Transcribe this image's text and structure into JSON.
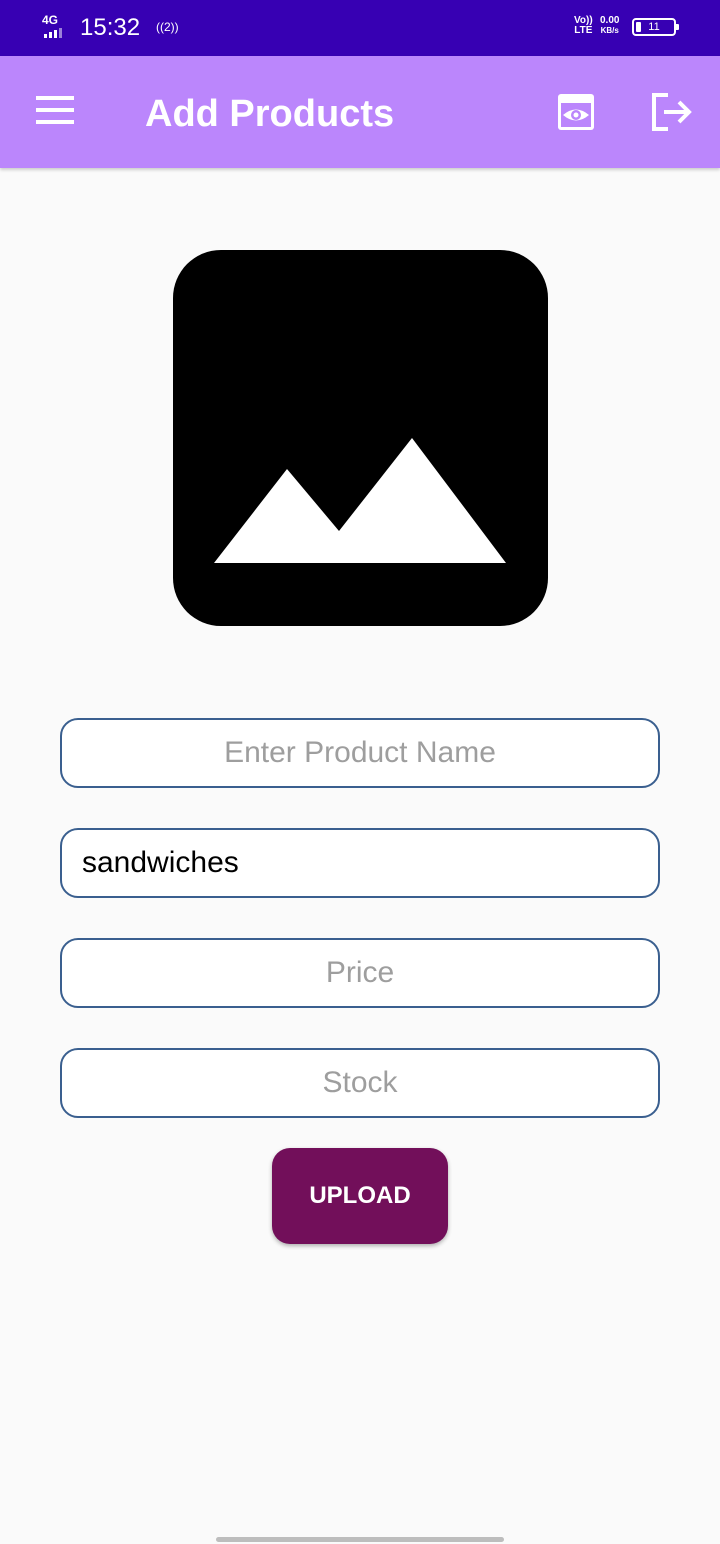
{
  "status_bar": {
    "network": "4G",
    "time": "15:32",
    "hotspot_label": "((2))",
    "volte": "Vo))",
    "lte": "LTE",
    "speed_value": "0.00",
    "speed_unit": "KB/s",
    "battery": "11",
    "signal_icon": "signal-icon",
    "hotspot_icon": "hotspot-icon",
    "battery_icon": "battery-icon"
  },
  "app_bar": {
    "title": "Add Products",
    "background": "#bb86fc",
    "menu_icon": "menu-icon",
    "view_icon": "eye-icon",
    "logout_icon": "logout-icon"
  },
  "product_image": {
    "icon": "image-placeholder-icon"
  },
  "form": {
    "product_name": {
      "placeholder": "Enter Product Name",
      "value": ""
    },
    "category": {
      "placeholder": "",
      "value": "sandwiches"
    },
    "price": {
      "placeholder": "Price",
      "value": ""
    },
    "stock": {
      "placeholder": "Stock",
      "value": ""
    },
    "field_border_color": "#3a5f8f"
  },
  "upload_button": {
    "label": "UPLOAD",
    "color": "#720f5a"
  },
  "colors": {
    "status_bar": "#3700b3",
    "background": "#fafafa"
  }
}
